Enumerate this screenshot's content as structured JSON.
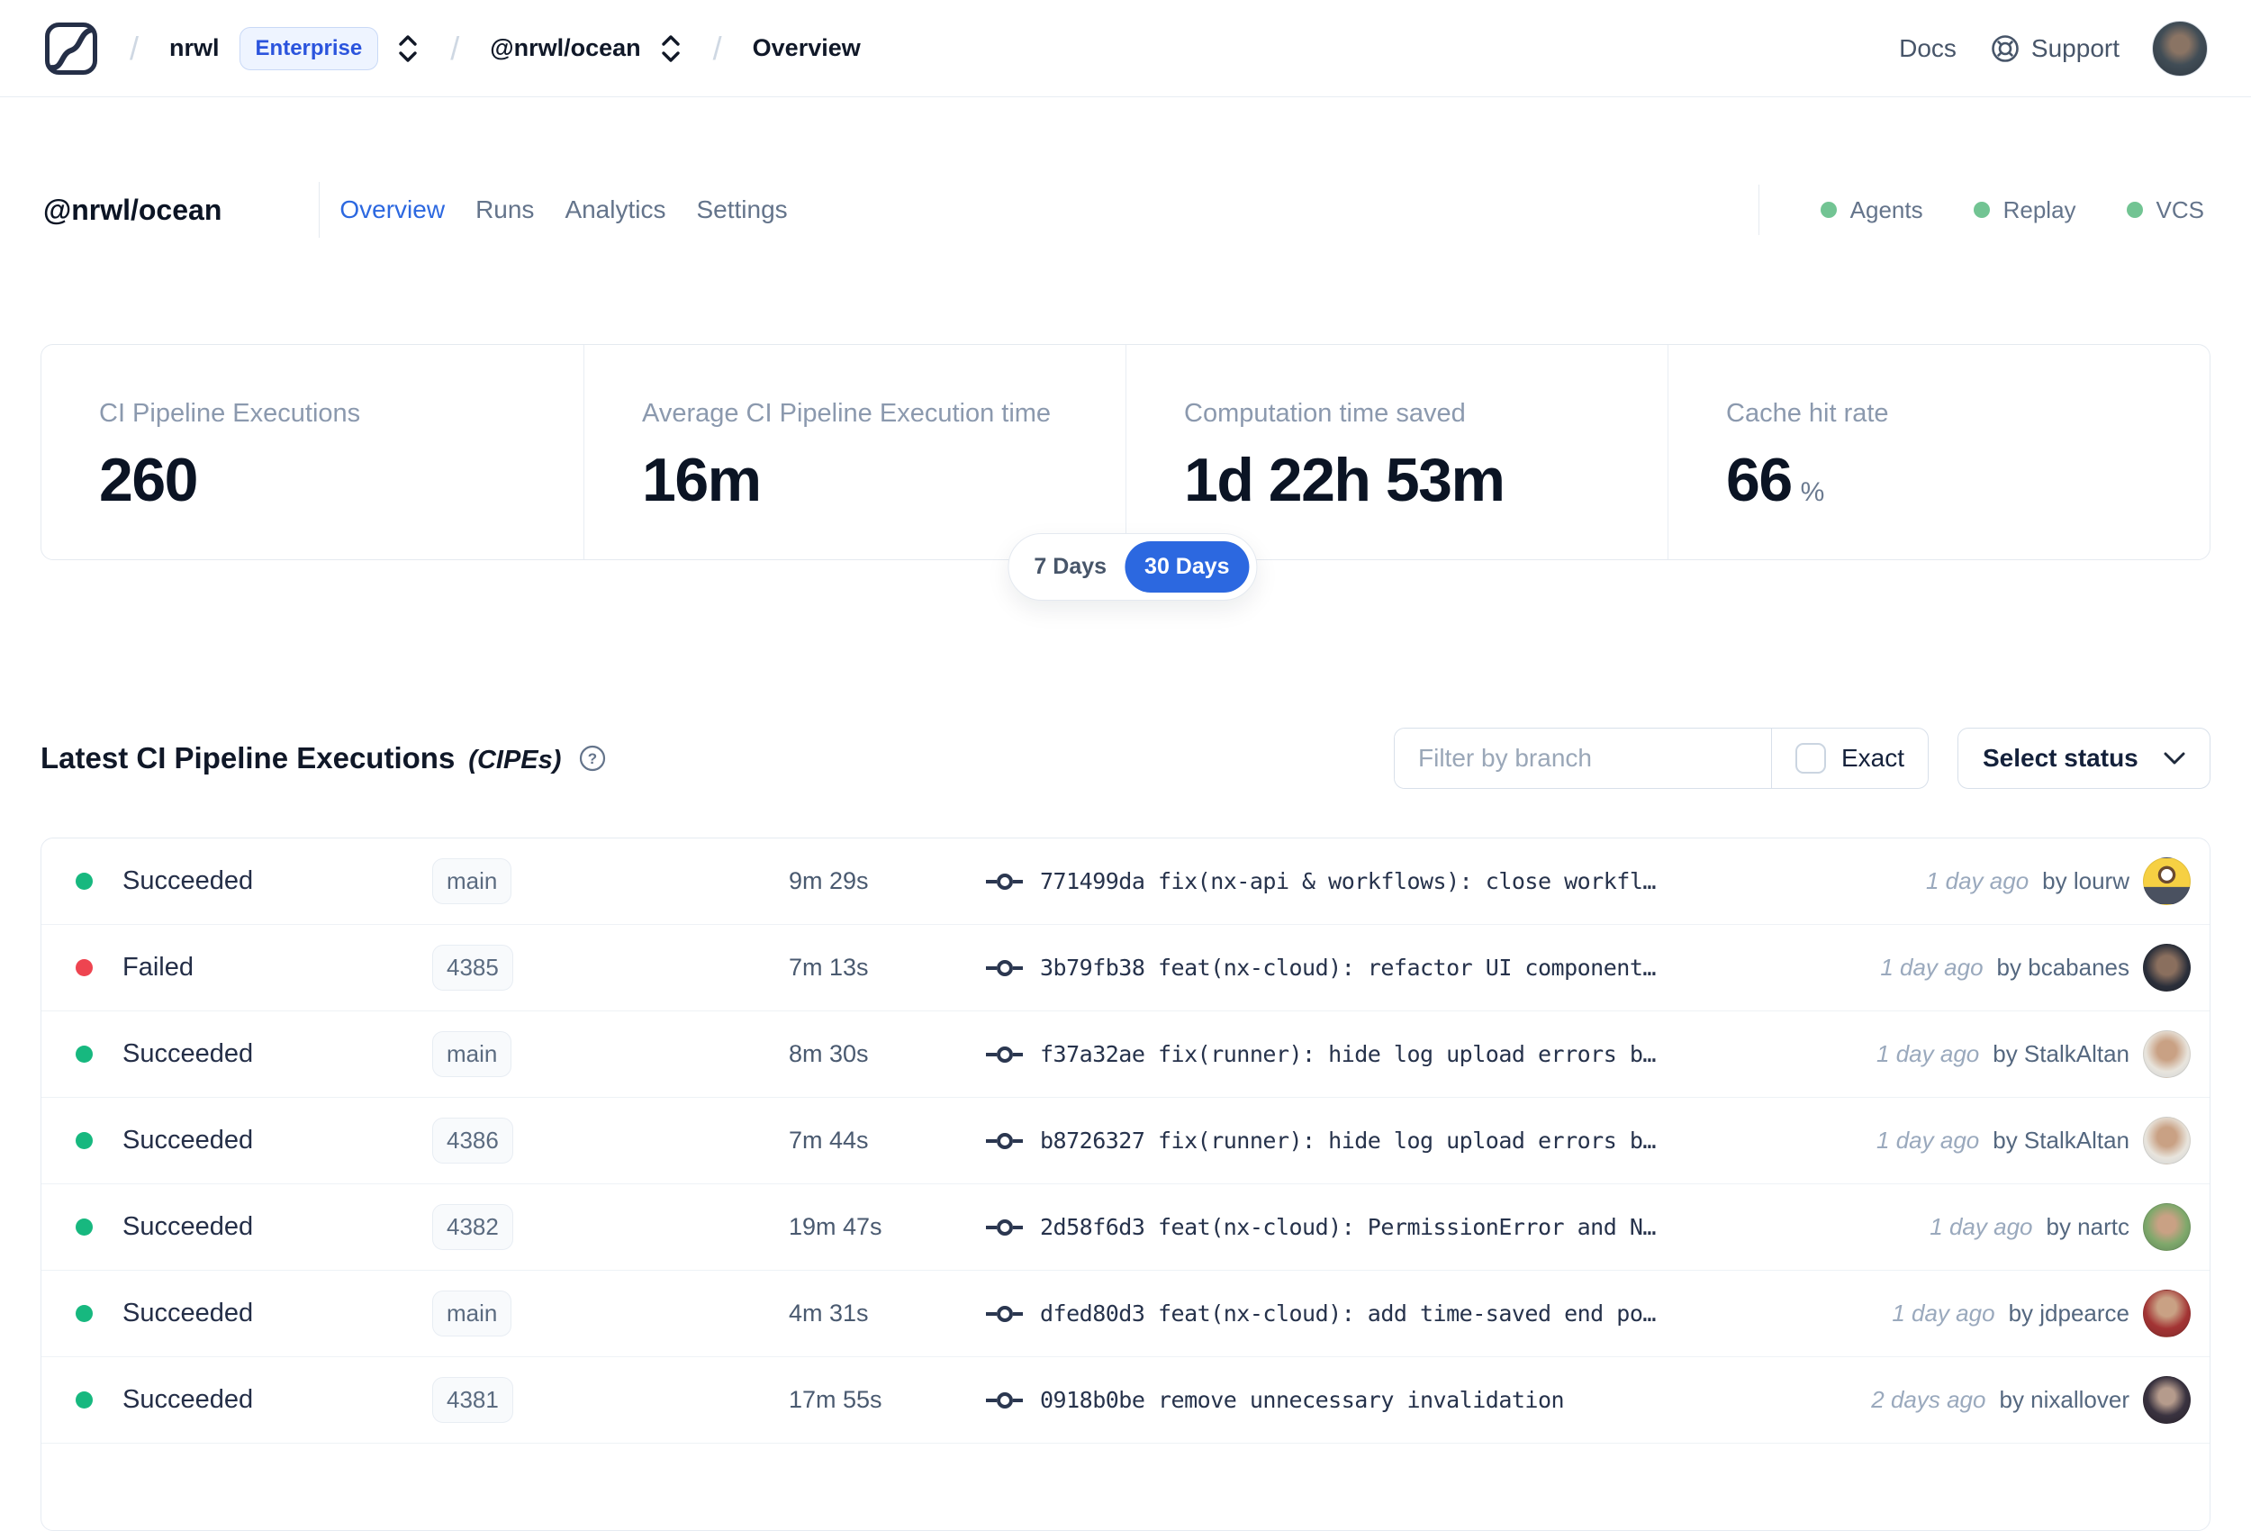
{
  "colors": {
    "accent_blue": "#2c68e0",
    "success_green": "#17b87f",
    "failed_red": "#ee4450",
    "service_green": "#72c493"
  },
  "nav": {
    "breadcrumb": {
      "separator": "/",
      "org": "nrwl",
      "org_badge": "Enterprise",
      "workspace": "@nrwl/ocean",
      "page": "Overview"
    },
    "docs_label": "Docs",
    "support_label": "Support"
  },
  "header": {
    "title": "@nrwl/ocean",
    "tabs": [
      {
        "label": "Overview",
        "active": true
      },
      {
        "label": "Runs",
        "active": false
      },
      {
        "label": "Analytics",
        "active": false
      },
      {
        "label": "Settings",
        "active": false
      }
    ],
    "services": [
      {
        "label": "Agents",
        "status": "online"
      },
      {
        "label": "Replay",
        "status": "online"
      },
      {
        "label": "VCS",
        "status": "online"
      }
    ]
  },
  "stats": {
    "cards": [
      {
        "label": "CI Pipeline Executions",
        "value": "260",
        "suffix": ""
      },
      {
        "label": "Average CI Pipeline Execution time",
        "value": "16m",
        "suffix": ""
      },
      {
        "label": "Computation time saved",
        "value": "1d 22h 53m",
        "suffix": ""
      },
      {
        "label": "Cache hit rate",
        "value": "66",
        "suffix": "%"
      }
    ],
    "range": {
      "options": [
        "7 Days",
        "30 Days"
      ],
      "selected": "30 Days"
    }
  },
  "section": {
    "title": "Latest CI Pipeline Executions",
    "title_suffix": "(CIPEs)",
    "filter": {
      "placeholder": "Filter by branch",
      "exact_label": "Exact",
      "exact_checked": false
    },
    "status_select_label": "Select status"
  },
  "table": {
    "rows": [
      {
        "status": "Succeeded",
        "branch": "main",
        "duration": "9m 29s",
        "commit": "771499da",
        "message": "fix(nx-api & workflows): close workfl…",
        "time": "1 day ago",
        "author": "by lourw"
      },
      {
        "status": "Failed",
        "branch": "4385",
        "duration": "7m 13s",
        "commit": "3b79fb38",
        "message": "feat(nx-cloud): refactor UI component…",
        "time": "1 day ago",
        "author": "by bcabanes"
      },
      {
        "status": "Succeeded",
        "branch": "main",
        "duration": "8m 30s",
        "commit": "f37a32ae",
        "message": "fix(runner): hide log upload errors b…",
        "time": "1 day ago",
        "author": "by StalkAltan"
      },
      {
        "status": "Succeeded",
        "branch": "4386",
        "duration": "7m 44s",
        "commit": "b8726327",
        "message": "fix(runner): hide log upload errors b…",
        "time": "1 day ago",
        "author": "by StalkAltan"
      },
      {
        "status": "Succeeded",
        "branch": "4382",
        "duration": "19m 47s",
        "commit": "2d58f6d3",
        "message": "feat(nx-cloud): PermissionError and N…",
        "time": "1 day ago",
        "author": "by nartc"
      },
      {
        "status": "Succeeded",
        "branch": "main",
        "duration": "4m 31s",
        "commit": "dfed80d3",
        "message": "feat(nx-cloud): add time-saved end po…",
        "time": "1 day ago",
        "author": "by jdpearce"
      },
      {
        "status": "Succeeded",
        "branch": "4381",
        "duration": "17m 55s",
        "commit": "0918b0be",
        "message": "remove unnecessary invalidation",
        "time": "2 days ago",
        "author": "by nixallover"
      }
    ]
  }
}
